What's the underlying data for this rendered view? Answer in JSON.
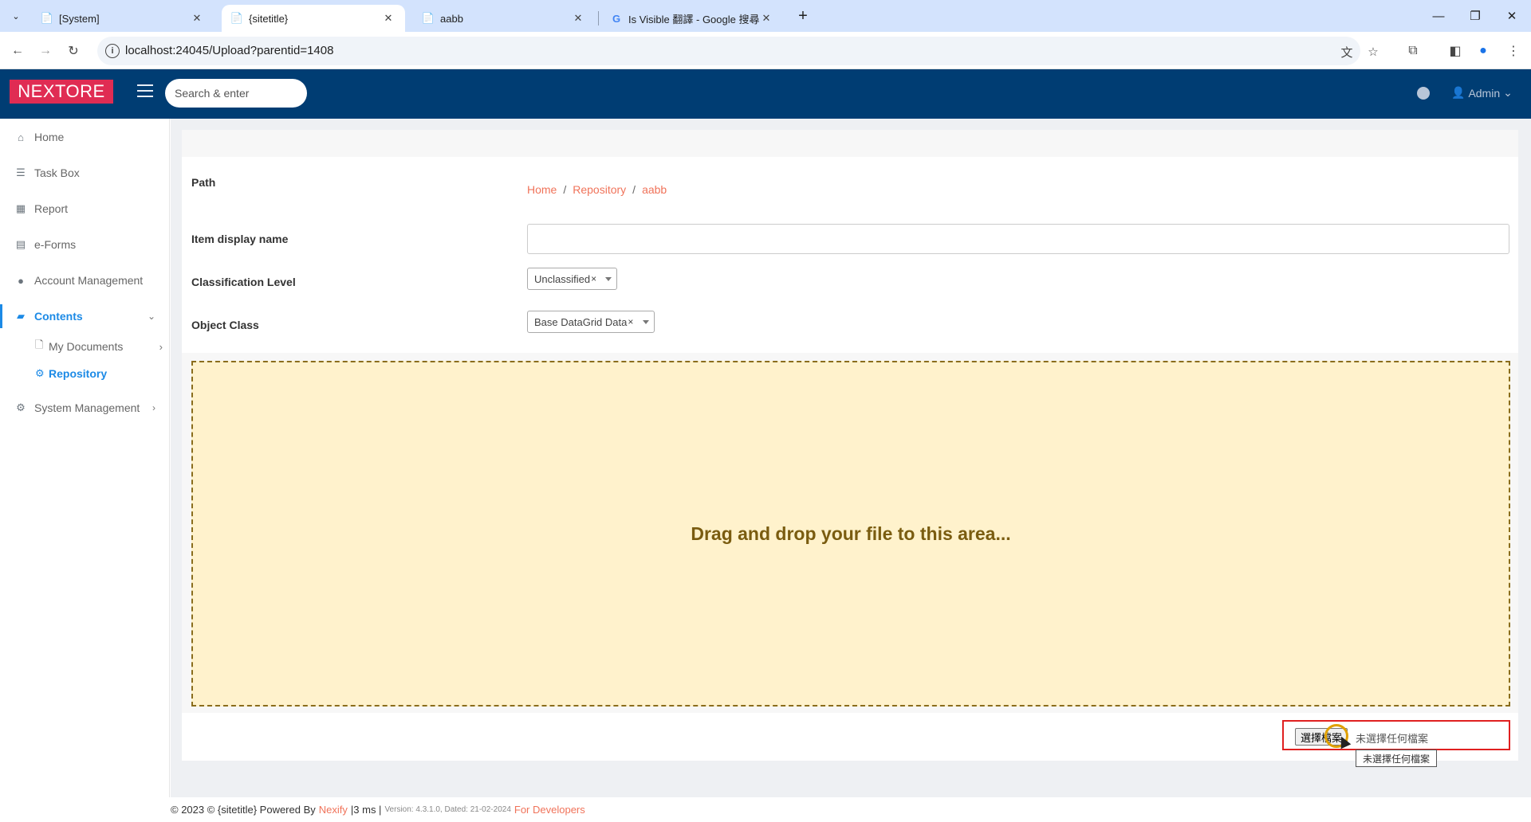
{
  "browser": {
    "tabs": [
      {
        "title": "[System]",
        "active": false
      },
      {
        "title": "{sitetitle}",
        "active": true
      },
      {
        "title": "aabb",
        "active": false
      },
      {
        "title": "Is Visible 翻譯 - Google 搜尋",
        "active": false
      }
    ],
    "url": "localhost:24045/Upload?parentid=1408"
  },
  "header": {
    "logo": "NEXTORE",
    "search_placeholder": "Search & enter",
    "user": "Admin"
  },
  "sidebar": {
    "items": [
      {
        "label": "Home",
        "icon": "home-icon"
      },
      {
        "label": "Task Box",
        "icon": "tasks-icon"
      },
      {
        "label": "Report",
        "icon": "table-icon"
      },
      {
        "label": "e-Forms",
        "icon": "form-icon"
      },
      {
        "label": "Account Management",
        "icon": "user-icon"
      },
      {
        "label": "Contents",
        "icon": "folder-icon",
        "active": true
      },
      {
        "label": "System Management",
        "icon": "cogs-icon"
      }
    ],
    "subitems": [
      {
        "label": "My Documents",
        "icon": "file-icon"
      },
      {
        "label": "Repository",
        "icon": "gear-icon",
        "active": true
      }
    ]
  },
  "form": {
    "path_label": "Path",
    "breadcrumb": [
      "Home",
      "Repository",
      "aabb"
    ],
    "display_name_label": "Item display name",
    "display_name_value": "",
    "classification_label": "Classification Level",
    "classification_value": "Unclassified",
    "object_class_label": "Object Class",
    "object_class_value": "Base DataGrid Data",
    "clear_glyph": "×"
  },
  "dropzone": {
    "message": "Drag and drop your file to this area..."
  },
  "file_input": {
    "button_label": "選擇檔案",
    "status": "未選擇任何檔案",
    "tooltip": "未選擇任何檔案"
  },
  "footer": {
    "copyright": "© 2023 © {sitetitle} Powered By",
    "brand": "Nexify",
    "timing": "|3 ms |",
    "version": "Version: 4.3.1.0, Dated: 21-02-2024",
    "dev_link": "For Developers"
  },
  "colors": {
    "header_bg": "#003d73",
    "logo_bg": "#e02c53",
    "accent": "#1c8ae6",
    "link": "#f0735a",
    "dropzone_bg": "#fff2cc"
  }
}
